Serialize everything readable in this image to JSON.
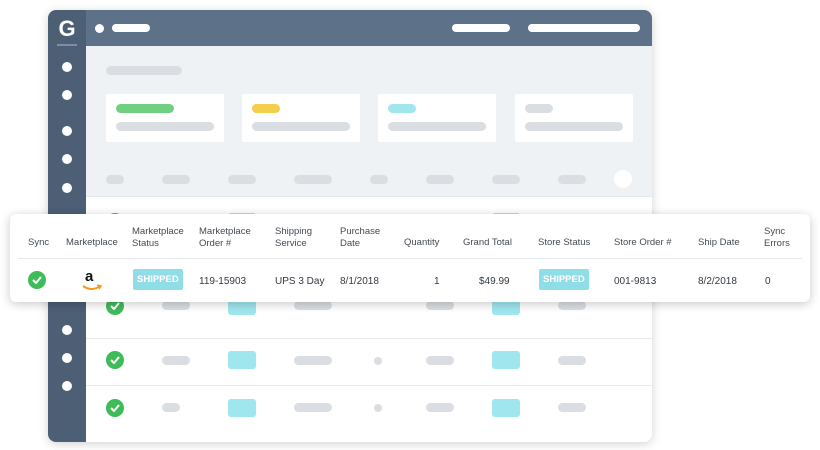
{
  "app": {
    "logo_text": "G",
    "nav_count": 10
  },
  "table": {
    "headers": {
      "sync": "Sync",
      "marketplace": "Marketplace",
      "marketplace_status_1": "Marketplace",
      "marketplace_status_2": "Status",
      "marketplace_order_1": "Marketplace",
      "marketplace_order_2": "Order #",
      "shipping_service_1": "Shipping",
      "shipping_service_2": "Service",
      "purchase_date_1": "Purchase",
      "purchase_date_2": "Date",
      "quantity": "Quantity",
      "grand_total": "Grand Total",
      "store_status": "Store Status",
      "store_order": "Store Order #",
      "ship_date": "Ship Date",
      "sync_errors_1": "Sync",
      "sync_errors_2": "Errors"
    },
    "row": {
      "sync_icon": "check-circle-icon",
      "marketplace_logo": "amazon-logo",
      "marketplace_logo_text": "a",
      "marketplace_status": "SHIPPED",
      "marketplace_order": "119-15903",
      "shipping_service": "UPS 3 Day",
      "purchase_date": "8/1/2018",
      "quantity": "1",
      "grand_total": "$49.99",
      "store_status": "SHIPPED",
      "store_order": "001-9813",
      "ship_date": "8/2/2018",
      "sync_errors": "0"
    }
  },
  "colors": {
    "sidebar": "#4c5f75",
    "topbar": "#5d7189",
    "success": "#3fbc5a",
    "badge": "#8fdde6",
    "card_green": "#6fd17f",
    "card_yellow": "#f4cf4a",
    "card_cyan": "#a0e6ee"
  }
}
